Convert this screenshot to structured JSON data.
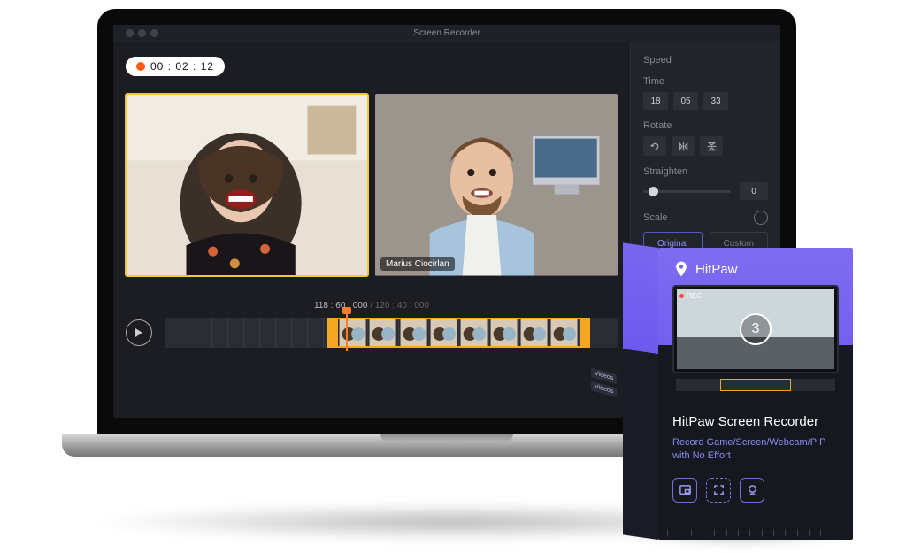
{
  "app": {
    "title": "Screen Recorder"
  },
  "recording": {
    "time": "00 : 02 : 12"
  },
  "clips": {
    "name_tag": "Marius Ciocirlan"
  },
  "timeline": {
    "current": "118 : 60 : 000",
    "total": "120 : 40 : 000"
  },
  "sidebar": {
    "speed_label": "Speed",
    "time_label": "Time",
    "time_h": "18",
    "time_m": "05",
    "time_s": "33",
    "rotate_label": "Rotate",
    "straighten_label": "Straighten",
    "straighten_value": "0",
    "scale_label": "Scale",
    "scale_original": "Original",
    "scale_custom": "Custom"
  },
  "product": {
    "brand": "HitPaw",
    "counter": "3",
    "rec_label": "REC",
    "title": "HitPaw Screen Recorder",
    "subtitle": "Record Game/Screen/Webcam/PIP with No Effort",
    "side_tag1": "Videos",
    "side_tag2": "Videos"
  }
}
